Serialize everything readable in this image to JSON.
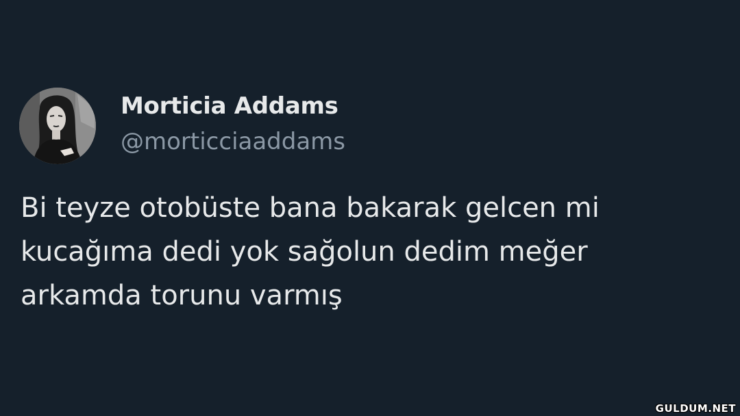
{
  "tweet": {
    "author": {
      "display_name": "Morticia Addams",
      "handle": "@morticciaaddams"
    },
    "text_lines": [
      "Bi teyze otobüste bana bakarak gelcen mi",
      "kucağıma dedi yok sağolun dedim meğer",
      "arkamda torunu varmış"
    ]
  },
  "watermark": "GULDUM.NET",
  "colors": {
    "background": "#15202b",
    "text_primary": "#e7e9ea",
    "text_secondary": "#8b98a5"
  }
}
